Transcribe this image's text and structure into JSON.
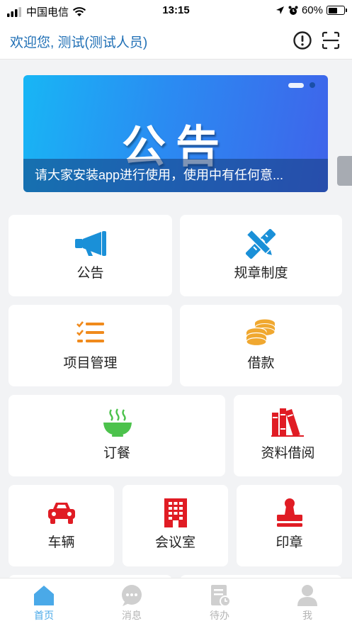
{
  "status_bar": {
    "carrier": "中国电信",
    "time": "13:15",
    "battery": "60%",
    "battery_level": 0.6
  },
  "header": {
    "welcome": "欢迎您, 测试(测试人员)",
    "info_icon": "exclamation-circle-icon",
    "scan_icon": "scan-icon"
  },
  "banner": {
    "big_text": "公告",
    "caption": "请大家安装app进行使用，使用中有任何意..."
  },
  "grid": {
    "announcement": {
      "label": "公告",
      "icon": "megaphone-icon",
      "color": "#1a90d8"
    },
    "regulations": {
      "label": "规章制度",
      "icon": "pencil-ruler-icon",
      "color": "#1a90d8"
    },
    "projects": {
      "label": "项目管理",
      "icon": "checklist-icon",
      "color": "#f08a1c"
    },
    "loan": {
      "label": "借款",
      "icon": "coins-icon",
      "color": "#f0a830"
    },
    "ordering": {
      "label": "订餐",
      "icon": "bowl-icon",
      "color": "#4cc24c"
    },
    "library": {
      "label": "资料借阅",
      "icon": "books-icon",
      "color": "#e01c24"
    },
    "vehicle": {
      "label": "车辆",
      "icon": "car-icon",
      "color": "#e01c24"
    },
    "meeting_room": {
      "label": "会议室",
      "icon": "building-icon",
      "color": "#e01c24"
    },
    "seal": {
      "label": "印章",
      "icon": "stamp-icon",
      "color": "#e01c24"
    }
  },
  "tabbar": {
    "home": "首页",
    "messages": "消息",
    "todo": "待办",
    "me": "我",
    "active_color": "#4aa9e8",
    "inactive_color": "#b4b4b4"
  }
}
